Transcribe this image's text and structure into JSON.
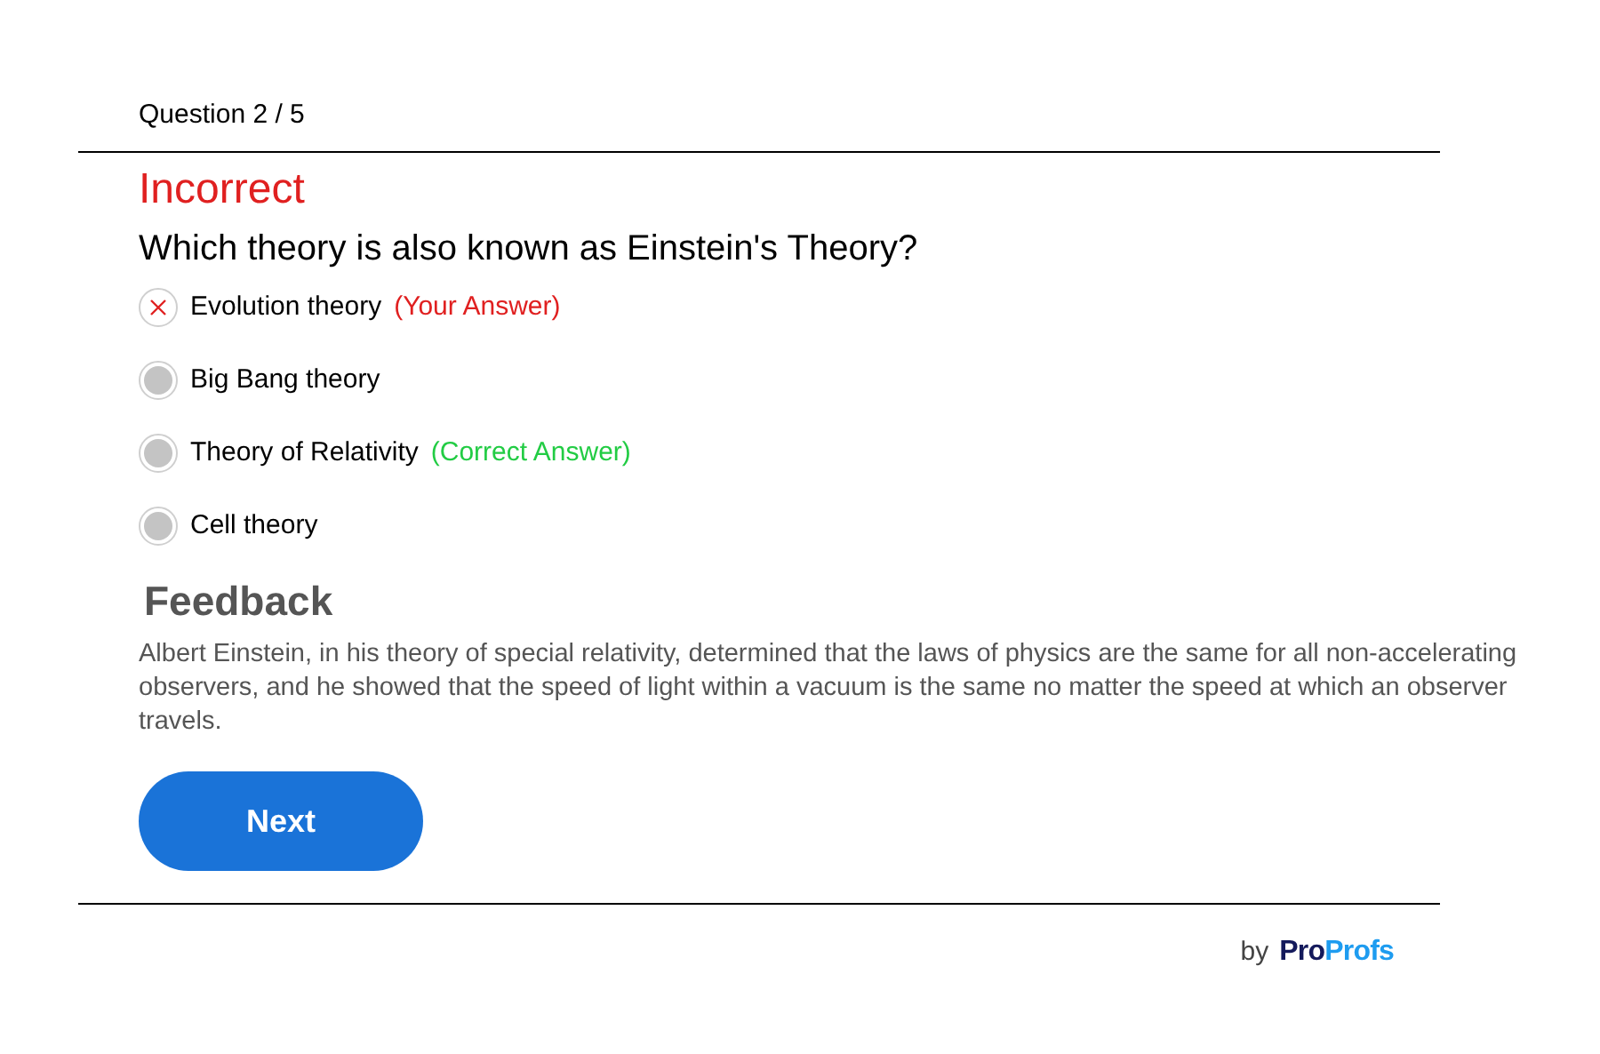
{
  "progress": "Question 2 / 5",
  "result": {
    "label": "Incorrect",
    "kind": "incorrect"
  },
  "question": "Which theory is also known as Einstein's Theory?",
  "options": [
    {
      "label": "Evolution theory",
      "kind": "wrong",
      "tag": "(Your Answer)",
      "color": "#e02020"
    },
    {
      "label": "Big Bang theory",
      "kind": "plain"
    },
    {
      "label": "Theory of Relativity",
      "kind": "plain",
      "tag": "(Correct Answer)",
      "color": "#22cc44"
    },
    {
      "label": "Cell theory",
      "kind": "plain"
    }
  ],
  "feedback": {
    "title": "Feedback",
    "text": "Albert Einstein, in his theory of special relativity, determined that the laws of physics are the same for all non-accelerating observers, and he showed that the speed of light within a vacuum is the same no matter the speed at which an observer travels."
  },
  "next_button": "Next",
  "footer": {
    "by": "by",
    "logo_parts": [
      "Pro",
      "Profs"
    ]
  }
}
